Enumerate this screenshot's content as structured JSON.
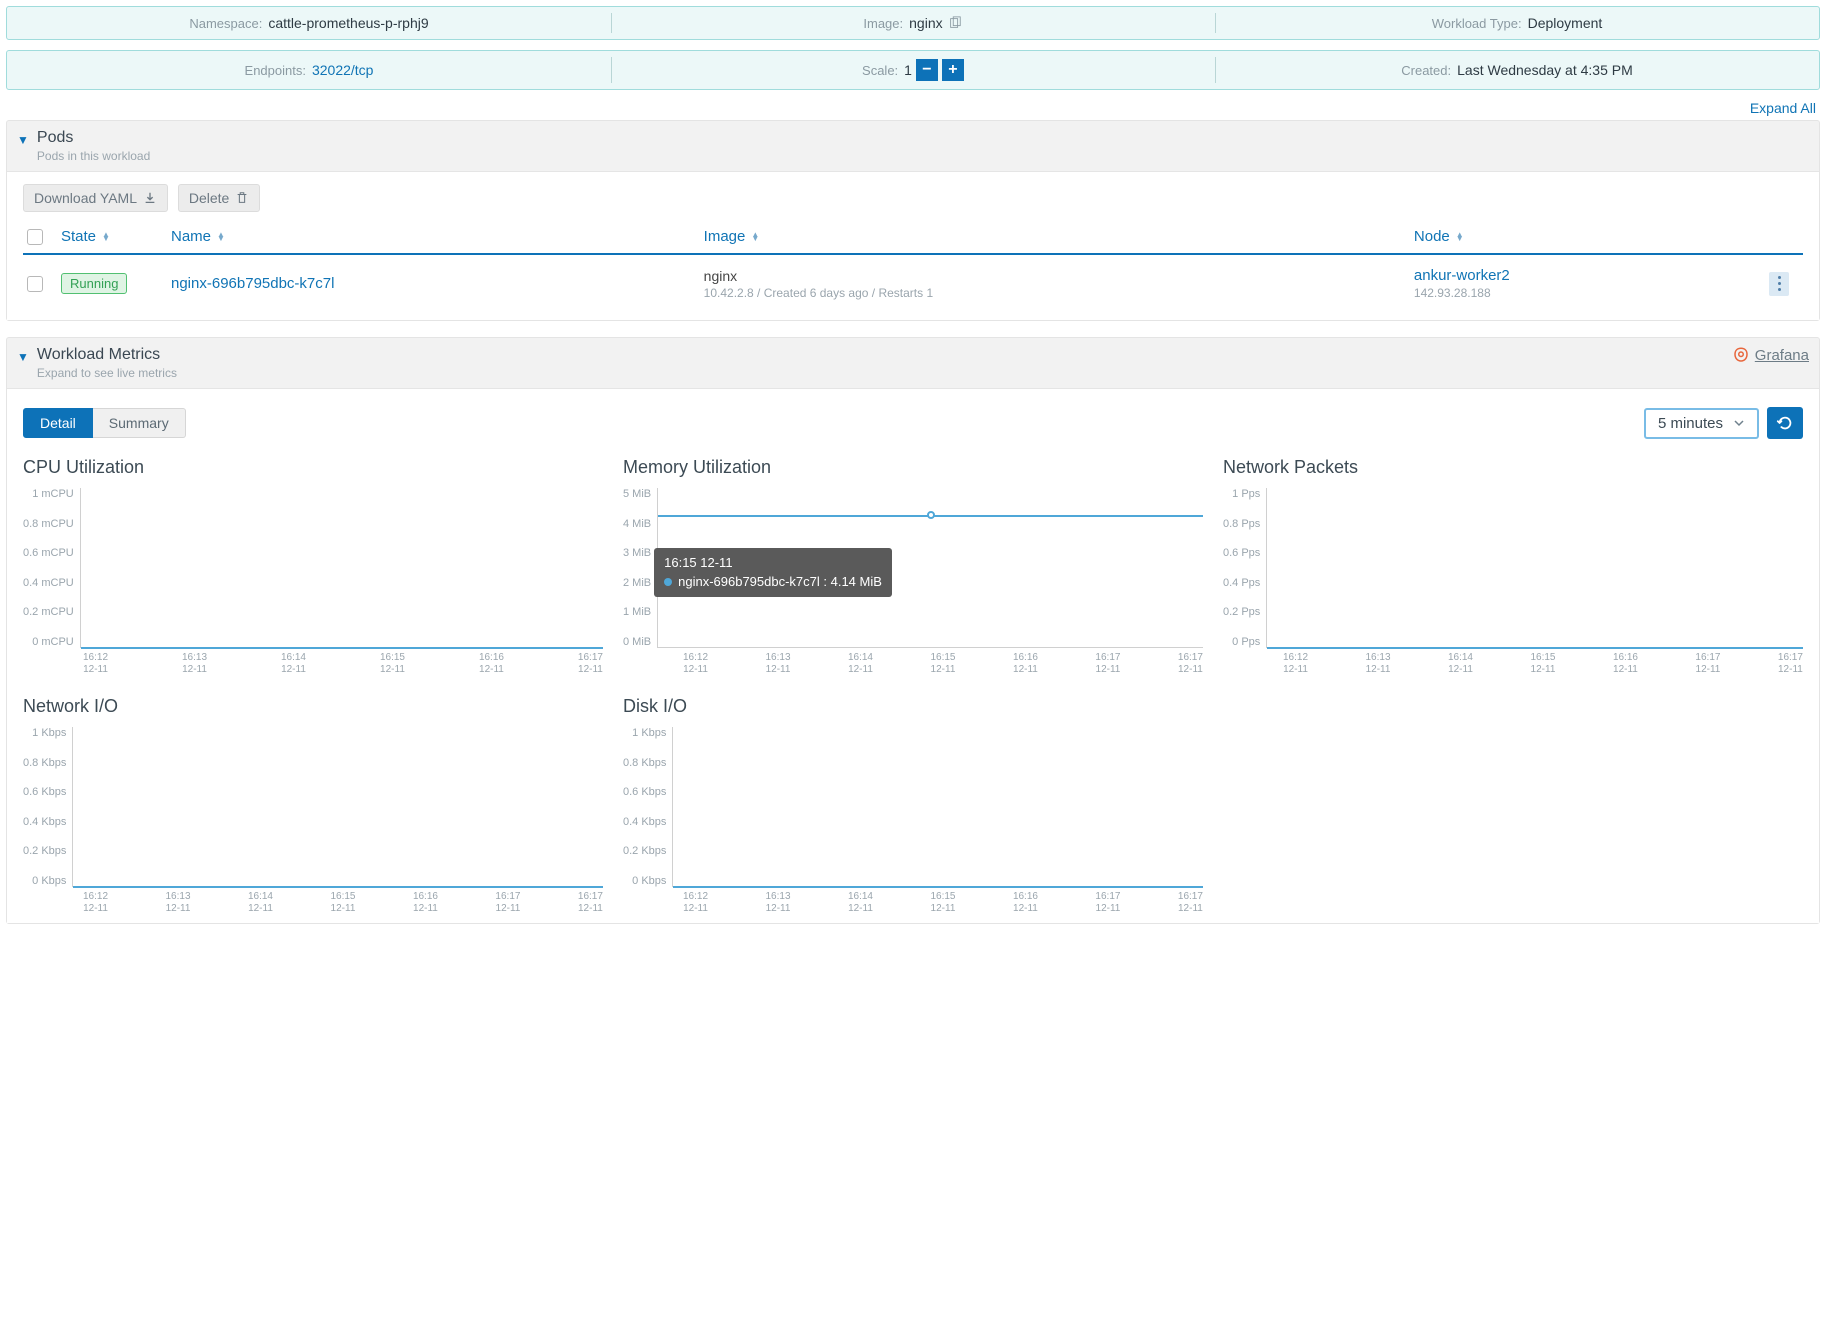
{
  "info1": {
    "namespace": {
      "label": "Namespace:",
      "value": "cattle-prometheus-p-rphj9"
    },
    "image": {
      "label": "Image:",
      "value": "nginx"
    },
    "wtype": {
      "label": "Workload Type:",
      "value": "Deployment"
    }
  },
  "info2": {
    "endpoints": {
      "label": "Endpoints:",
      "value": "32022/tcp"
    },
    "scale": {
      "label": "Scale:",
      "value": "1"
    },
    "created": {
      "label": "Created:",
      "value": "Last Wednesday at 4:35 PM"
    }
  },
  "expand_all": "Expand All",
  "pods_section": {
    "title": "Pods",
    "subtitle": "Pods in this workload",
    "download_btn": "Download YAML",
    "delete_btn": "Delete",
    "columns": {
      "state": "State",
      "name": "Name",
      "image": "Image",
      "node": "Node"
    },
    "row": {
      "state": "Running",
      "name": "nginx-696b795dbc-k7c7l",
      "image": "nginx",
      "image_sub": "10.42.2.8 / Created 6 days ago / Restarts 1",
      "node": "ankur-worker2",
      "node_sub": "142.93.28.188"
    }
  },
  "metrics_section": {
    "title": "Workload Metrics",
    "subtitle": "Expand to see live metrics",
    "grafana": "Grafana",
    "tabs": {
      "detail": "Detail",
      "summary": "Summary"
    },
    "time_range": "5 minutes"
  },
  "tooltip": {
    "time": "16:15 12-11",
    "series": "nginx-696b795dbc-k7c7l : 4.14 MiB"
  },
  "chart_data": [
    {
      "id": "cpu",
      "type": "line",
      "title": "CPU Utilization",
      "y_ticks": [
        "1 mCPU",
        "0.8 mCPU",
        "0.6 mCPU",
        "0.4 mCPU",
        "0.2 mCPU",
        "0 mCPU"
      ],
      "x_ticks": [
        "16:12 12-11",
        "16:13 12-11",
        "16:14 12-11",
        "16:15 12-11",
        "16:16 12-11",
        "16:17 12-11"
      ],
      "ylim": [
        0,
        1
      ],
      "series": [
        {
          "name": "nginx-696b795dbc-k7c7l",
          "values": [
            0,
            0,
            0,
            0,
            0,
            0
          ]
        }
      ]
    },
    {
      "id": "mem",
      "type": "line",
      "title": "Memory Utilization",
      "y_ticks": [
        "5 MiB",
        "4 MiB",
        "3 MiB",
        "2 MiB",
        "1 MiB",
        "0 MiB"
      ],
      "x_ticks": [
        "16:12 12-11",
        "16:13 12-11",
        "16:14 12-11",
        "16:15 12-11",
        "16:16 12-11",
        "16:17 12-11",
        "16:17 12-11"
      ],
      "ylim": [
        0,
        5
      ],
      "series": [
        {
          "name": "nginx-696b795dbc-k7c7l",
          "values": [
            4.18,
            4.18,
            4.14,
            4.14,
            4.14,
            4.14,
            4.14
          ]
        }
      ]
    },
    {
      "id": "netpkt",
      "type": "line",
      "title": "Network Packets",
      "y_ticks": [
        "1 Pps",
        "0.8 Pps",
        "0.6 Pps",
        "0.4 Pps",
        "0.2 Pps",
        "0 Pps"
      ],
      "x_ticks": [
        "16:12 12-11",
        "16:13 12-11",
        "16:14 12-11",
        "16:15 12-11",
        "16:16 12-11",
        "16:17 12-11",
        "16:17 12-11"
      ],
      "ylim": [
        0,
        1
      ],
      "series": [
        {
          "name": "nginx-696b795dbc-k7c7l",
          "values": [
            0,
            0,
            0,
            0,
            0,
            0,
            0
          ]
        }
      ]
    },
    {
      "id": "netio",
      "type": "line",
      "title": "Network I/O",
      "y_ticks": [
        "1 Kbps",
        "0.8 Kbps",
        "0.6 Kbps",
        "0.4 Kbps",
        "0.2 Kbps",
        "0 Kbps"
      ],
      "x_ticks": [
        "16:12 12-11",
        "16:13 12-11",
        "16:14 12-11",
        "16:15 12-11",
        "16:16 12-11",
        "16:17 12-11",
        "16:17 12-11"
      ],
      "ylim": [
        0,
        1
      ],
      "series": [
        {
          "name": "nginx-696b795dbc-k7c7l",
          "values": [
            0,
            0,
            0,
            0,
            0,
            0,
            0
          ]
        }
      ]
    },
    {
      "id": "diskio",
      "type": "line",
      "title": "Disk I/O",
      "y_ticks": [
        "1 Kbps",
        "0.8 Kbps",
        "0.6 Kbps",
        "0.4 Kbps",
        "0.2 Kbps",
        "0 Kbps"
      ],
      "x_ticks": [
        "16:12 12-11",
        "16:13 12-11",
        "16:14 12-11",
        "16:15 12-11",
        "16:16 12-11",
        "16:17 12-11",
        "16:17 12-11"
      ],
      "ylim": [
        0,
        1
      ],
      "series": [
        {
          "name": "nginx-696b795dbc-k7c7l",
          "values": [
            0,
            0,
            0,
            0,
            0,
            0,
            0
          ]
        }
      ]
    }
  ]
}
